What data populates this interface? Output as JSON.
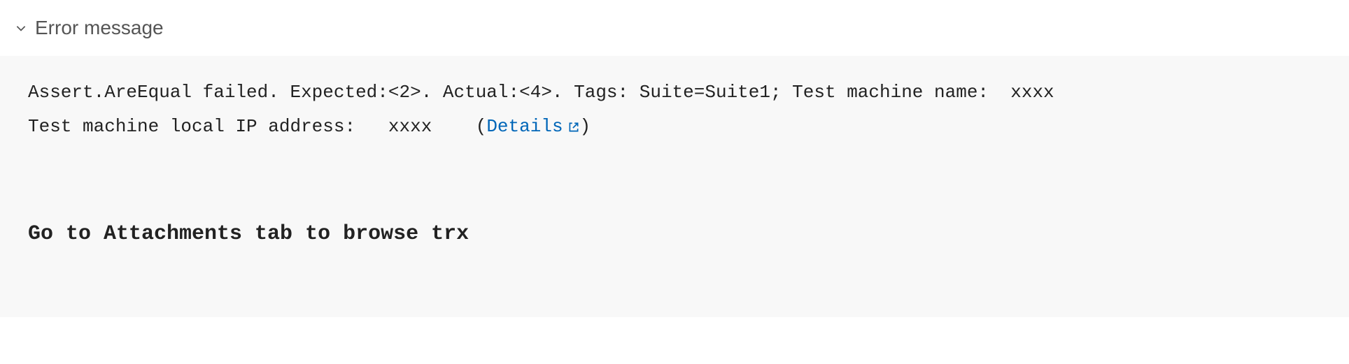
{
  "header": {
    "title": "Error message"
  },
  "error": {
    "line1_prefix": "Assert.AreEqual failed. Expected:<2>. Actual:<4>. Tags: Suite=Suite1; Test machine name:  ",
    "line1_machine": "xxxx",
    "line2_prefix": "Test machine local IP address:   ",
    "line2_ip": "xxxx",
    "line2_gap": "    (",
    "details_label": "Details",
    "line2_close": ")",
    "hint": "Go to Attachments tab to browse trx"
  }
}
